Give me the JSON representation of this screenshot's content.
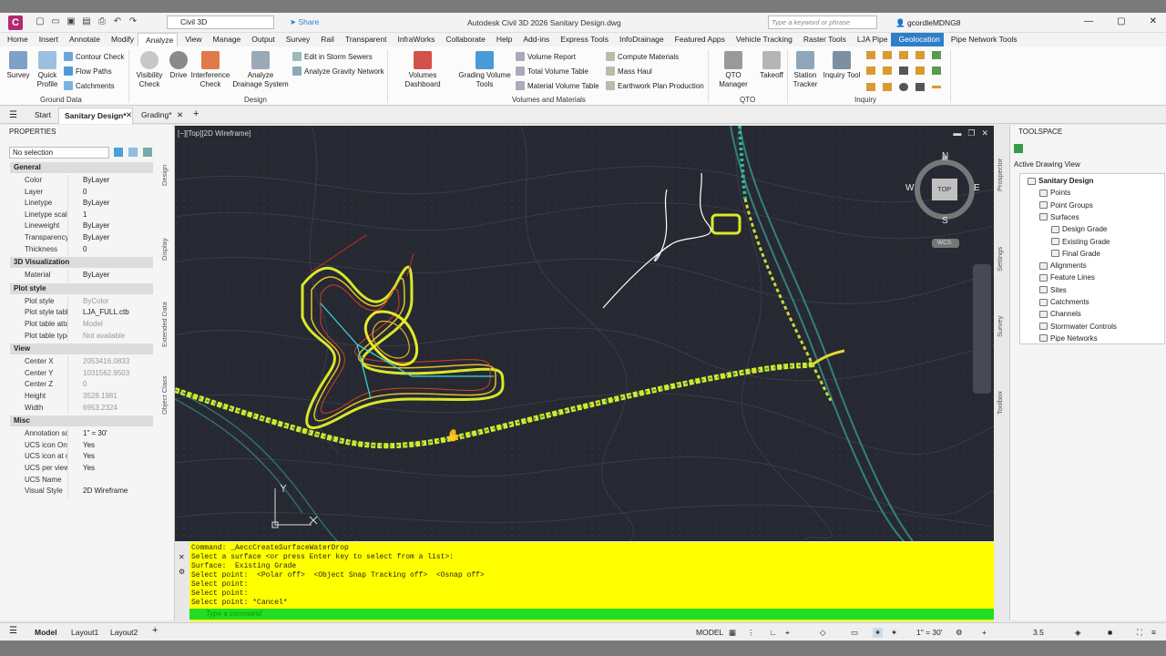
{
  "title_bar": {
    "logo": "C",
    "workspace": "Civil 3D",
    "share": "Share",
    "title": "Autodesk Civil 3D 2026   Sanitary Design.dwg",
    "search_placeholder": "Type a keyword or phrase",
    "user": "gcordleMDNG8"
  },
  "ribbon_tabs": [
    "Home",
    "Insert",
    "Annotate",
    "Modify",
    "Analyze",
    "View",
    "Manage",
    "Output",
    "Survey",
    "Rail",
    "Transparent",
    "InfraWorks",
    "Collaborate",
    "Help",
    "Add-ins",
    "Express Tools",
    "InfoDrainage",
    "Featured Apps",
    "Vehicle Tracking",
    "Raster Tools",
    "LJA Pipe",
    "Geolocation",
    "Pipe Network Tools"
  ],
  "ribbon": {
    "survey": "Survey",
    "quick_profile": [
      "Quick",
      "Profile"
    ],
    "contour_check": "Contour Check",
    "flow_paths": "Flow Paths",
    "catchments": "Catchments",
    "ground_data": "Ground Data",
    "visibility_check": [
      "Visibility",
      "Check"
    ],
    "drive": "Drive",
    "interference_check": [
      "Interference",
      "Check"
    ],
    "analyze_drainage": [
      "Analyze",
      "Drainage System"
    ],
    "edit_storm": "Edit in Storm Sewers",
    "analyze_gravity": "Analyze Gravity Network",
    "design": "Design",
    "volumes_dashboard": "Volumes Dashboard",
    "grading_volume": [
      "Grading Volume",
      "Tools"
    ],
    "volume_report": "Volume Report",
    "total_volume": "Total Volume Table",
    "material_volume": "Material Volume Table",
    "compute_materials": "Compute Materials",
    "mass_haul": "Mass Haul",
    "earthwork_plan": "Earthwork Plan Production",
    "volumes_materials": "Volumes and Materials",
    "qto_manager": "QTO Manager",
    "takeoff": "Takeoff",
    "qto": "QTO",
    "station_tracker": [
      "Station",
      "Tracker"
    ],
    "inquiry_tool": "Inquiry Tool",
    "inquiry": "Inquiry"
  },
  "doc_tabs": {
    "start": "Start",
    "sanitary": "Sanitary Design*",
    "grading": "Grading*"
  },
  "properties": {
    "header": "PROPERTIES",
    "selection": "No selection",
    "sections": {
      "general": "General",
      "viz": "3D Visualization",
      "plot": "Plot style",
      "view": "View",
      "misc": "Misc"
    },
    "general": [
      [
        "Color",
        "ByLayer"
      ],
      [
        "Layer",
        "0"
      ],
      [
        "Linetype",
        "ByLayer"
      ],
      [
        "Linetype scale",
        "1"
      ],
      [
        "Lineweight",
        "ByLayer"
      ],
      [
        "Transparency",
        "ByLayer"
      ],
      [
        "Thickness",
        "0"
      ]
    ],
    "viz": [
      [
        "Material",
        "ByLayer"
      ]
    ],
    "plot": [
      [
        "Plot style",
        "ByColor"
      ],
      [
        "Plot style table",
        "LJA_FULL.ctb"
      ],
      [
        "Plot table atta...",
        "Model"
      ],
      [
        "Plot table type",
        "Not available"
      ]
    ],
    "view": [
      [
        "Center X",
        "2053416.0833"
      ],
      [
        "Center Y",
        "1031562.9503"
      ],
      [
        "Center Z",
        "0"
      ],
      [
        "Height",
        "3528.1981"
      ],
      [
        "Width",
        "6953.2324"
      ]
    ],
    "misc": [
      [
        "Annotation sc...",
        "1\" = 30'"
      ],
      [
        "UCS icon On",
        "Yes"
      ],
      [
        "UCS icon at or...",
        "Yes"
      ],
      [
        "UCS per viewp...",
        "Yes"
      ],
      [
        "UCS Name",
        ""
      ],
      [
        "Visual Style",
        "2D Wireframe"
      ]
    ],
    "side_tabs": [
      "Design",
      "Display",
      "Extended Data",
      "Object Class"
    ]
  },
  "viewport": {
    "label": "[−][Top][2D Wireframe]",
    "compass": {
      "n": "N",
      "s": "S",
      "e": "E",
      "w": "W",
      "top": "TOP",
      "wcs": "WCS"
    }
  },
  "command": {
    "lines": [
      "Command: _AeccCreateSurfaceWaterDrop",
      "Select a surface <or press Enter key to select from a list>:",
      "Surface:  Existing Grade",
      "Select point:  <Polar off>  <Object Snap Tracking off>  <Osnap off>",
      "Select point:",
      "Select point:",
      "Select point: *Cancel*"
    ],
    "placeholder": "Type a command"
  },
  "toolspace": {
    "header": "TOOLSPACE",
    "view": "Active Drawing View",
    "tree": [
      "Sanitary Design",
      "Points",
      "Point Groups",
      "Surfaces",
      "Design Grade",
      "Existing Grade",
      "Final Grade",
      "Alignments",
      "Feature Lines",
      "Sites",
      "Catchments",
      "Channels",
      "Stormwater Controls",
      "Pipe Networks"
    ],
    "side_tabs": [
      "Prospector",
      "Settings",
      "Survey",
      "Toolbox"
    ]
  },
  "status": {
    "model_tab": "Model",
    "layout1": "Layout1",
    "layout2": "Layout2",
    "model": "MODEL",
    "scale": "1\" = 30'",
    "lineweight": "3.5"
  }
}
